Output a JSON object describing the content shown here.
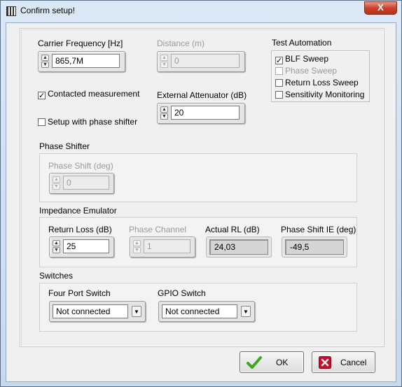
{
  "window": {
    "title": "Confirm setup!",
    "close_glyph": "X"
  },
  "carrier": {
    "label": "Carrier Frequency [Hz]",
    "value": "865,7M"
  },
  "distance": {
    "label": "Distance (m)",
    "value": "0"
  },
  "contacted": {
    "label": "Contacted measurement",
    "checked": true
  },
  "phase_shifter_setup": {
    "label": "Setup with phase shifter",
    "checked": false
  },
  "attenuator": {
    "label": "External Attenuator (dB)",
    "value": "20"
  },
  "test_automation": {
    "title": "Test Automation",
    "items": [
      {
        "label": "BLF Sweep",
        "checked": true,
        "enabled": true
      },
      {
        "label": "Phase Sweep",
        "checked": false,
        "enabled": false
      },
      {
        "label": "Return Loss Sweep",
        "checked": false,
        "enabled": true
      },
      {
        "label": "Sensitivity Monitoring",
        "checked": false,
        "enabled": true
      }
    ]
  },
  "phase_shifter": {
    "title": "Phase Shifter",
    "shift_label": "Phase Shift (deg)",
    "shift_value": "0"
  },
  "impedance": {
    "title": "Impedance Emulator",
    "return_loss_label": "Return Loss (dB)",
    "return_loss_value": "25",
    "phase_channel_label": "Phase Channel",
    "phase_channel_value": "1",
    "actual_rl_label": "Actual RL (dB)",
    "actual_rl_value": "24,03",
    "phase_shift_ie_label": "Phase Shift IE (deg)",
    "phase_shift_ie_value": "-49,5"
  },
  "switches": {
    "title": "Switches",
    "four_port_label": "Four Port Switch",
    "four_port_value": "Not connected",
    "gpio_label": "GPIO Switch",
    "gpio_value": "Not connected"
  },
  "buttons": {
    "ok": "OK",
    "cancel": "Cancel"
  },
  "colors": {
    "ok_check": "#3aa81e",
    "cancel_x": "#c8102e"
  }
}
